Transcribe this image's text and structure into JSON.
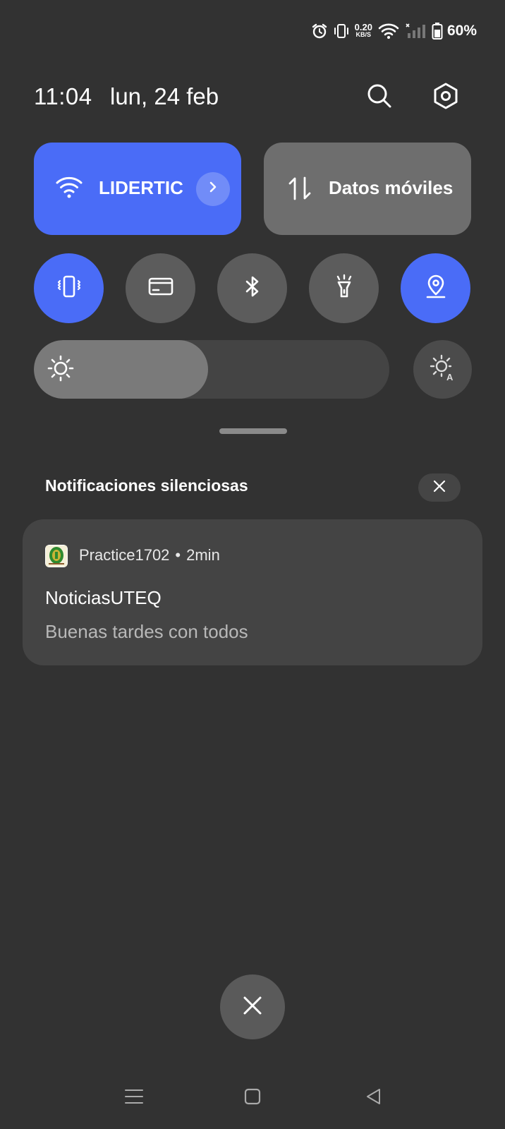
{
  "status_bar": {
    "icons": [
      "alarm-icon",
      "vibrate-icon",
      "wifi-icon",
      "signal-icon",
      "battery-icon"
    ],
    "net_speed_value": "0.20",
    "net_speed_unit": "KB/S",
    "battery": "60%"
  },
  "header": {
    "time": "11:04",
    "date": "lun, 24 feb"
  },
  "tiles": {
    "wifi_label": "LIDERTIC",
    "data_label": "Datos móviles"
  },
  "toggles": [
    {
      "name": "vibrate",
      "state": "on"
    },
    {
      "name": "nfc-card",
      "state": "off"
    },
    {
      "name": "bluetooth",
      "state": "off"
    },
    {
      "name": "flashlight",
      "state": "off"
    },
    {
      "name": "location",
      "state": "on"
    }
  ],
  "brightness": {
    "level": 0.49
  },
  "notifications": {
    "section_title": "Notificaciones silenciosas",
    "items": [
      {
        "app": "Practice1702",
        "separator": "•",
        "time": "2min",
        "title": "NoticiasUTEQ",
        "body": "Buenas tardes con todos"
      }
    ]
  },
  "colors": {
    "background": "#323232",
    "accent": "#4a6cf7",
    "tile_off": "#6e6e6e"
  }
}
